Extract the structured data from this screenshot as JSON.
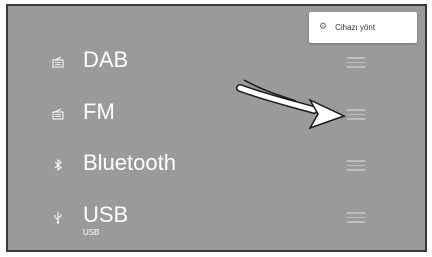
{
  "top_button": {
    "label": "Cihazı yönt",
    "icon": "gear-icon"
  },
  "sources": [
    {
      "label": "DAB",
      "icon": "radio-icon",
      "sub": ""
    },
    {
      "label": "FM",
      "icon": "radio-icon",
      "sub": ""
    },
    {
      "label": "Bluetooth",
      "icon": "bluetooth-icon",
      "sub": ""
    },
    {
      "label": "USB",
      "icon": "usb-icon",
      "sub": "USB"
    }
  ],
  "colors": {
    "background": "#9a9a9a",
    "text": "#ffffff",
    "arrow": "#ffffff",
    "arrow_outline": "#1a1a1a"
  }
}
